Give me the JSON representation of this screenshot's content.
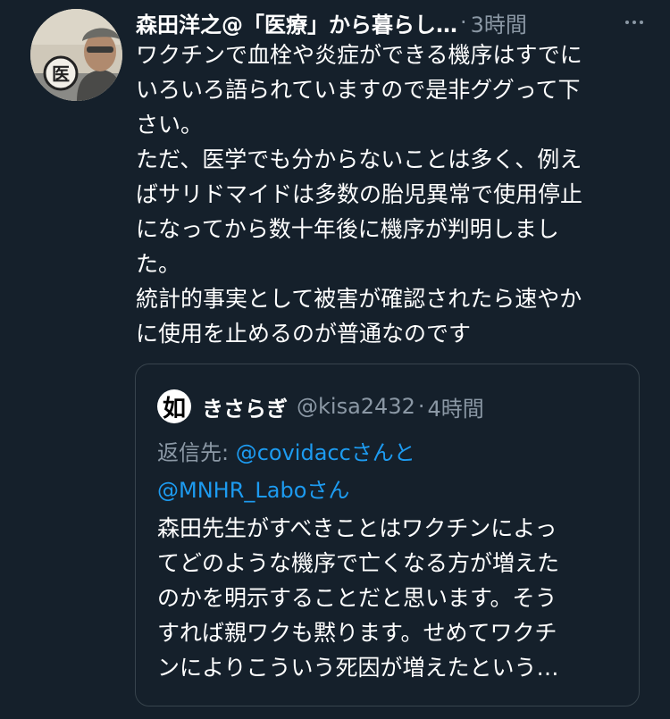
{
  "tweet": {
    "author_name": "森田洋之@「医療」から暮らし…",
    "dot": "·",
    "timestamp": "3時間",
    "avatar_icon": "user-avatar-photo",
    "more_icon": "more-options-icon",
    "lines": [
      "ワクチンで血栓や炎症ができる機序はすでに",
      "いろいろ語られていますので是非ググって下",
      "さい。",
      "ただ、医学でも分からないことは多く、例え",
      "ばサリドマイドは多数の胎児異常で使用停止",
      "になってから数十年後に機序が判明しまし",
      "た。",
      "統計的事実として被害が確認されたら速やか",
      "に使用を止めるのが普通なのです"
    ]
  },
  "quote": {
    "avatar_glyph": "如",
    "author_name": "きさらぎ",
    "handle": "@kisa2432",
    "dot": "·",
    "timestamp": "4時間",
    "reply_prefix": "返信先: ",
    "mention1": "@covidacc",
    "mention1_suffix": "さんと",
    "mention2": "@MNHR_Labo",
    "mention2_suffix": "さん",
    "lines": [
      "森田先生がすべきことはワクチンによっ",
      "てどのような機序で亡くなる方が増えた",
      "のかを明示することだと思います。そう",
      "すれば親ワクも黙ります。せめてワクチ",
      "ンによりこういう死因が増えたという…"
    ]
  },
  "colors": {
    "background": "#15202b",
    "text": "#ffffff",
    "secondary": "#8b98a5",
    "link": "#1d9bf0",
    "border": "#38444d"
  }
}
